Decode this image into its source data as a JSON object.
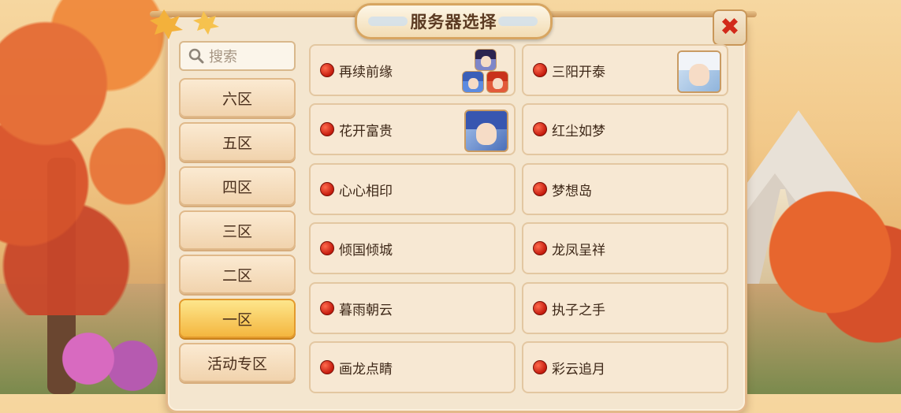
{
  "dialog": {
    "title": "服务器选择"
  },
  "search": {
    "placeholder": "搜索"
  },
  "zones": [
    {
      "label": "六区",
      "active": false
    },
    {
      "label": "五区",
      "active": false
    },
    {
      "label": "四区",
      "active": false
    },
    {
      "label": "三区",
      "active": false
    },
    {
      "label": "二区",
      "active": false
    },
    {
      "label": "一区",
      "active": true
    },
    {
      "label": "活动专区",
      "active": false
    }
  ],
  "servers": [
    {
      "name": "再续前缘"
    },
    {
      "name": "三阳开泰"
    },
    {
      "name": "花开富贵"
    },
    {
      "name": "红尘如梦"
    },
    {
      "name": "心心相印"
    },
    {
      "name": "梦想岛"
    },
    {
      "name": "倾国倾城"
    },
    {
      "name": "龙凤呈祥"
    },
    {
      "name": "暮雨朝云"
    },
    {
      "name": "执子之手"
    },
    {
      "name": "画龙点睛"
    },
    {
      "name": "彩云追月"
    }
  ],
  "colors": {
    "status_dot": "#d0200f",
    "active_zone": "#f4b63f",
    "panel": "#f4e6cf",
    "close_x": "#d22a1a"
  }
}
